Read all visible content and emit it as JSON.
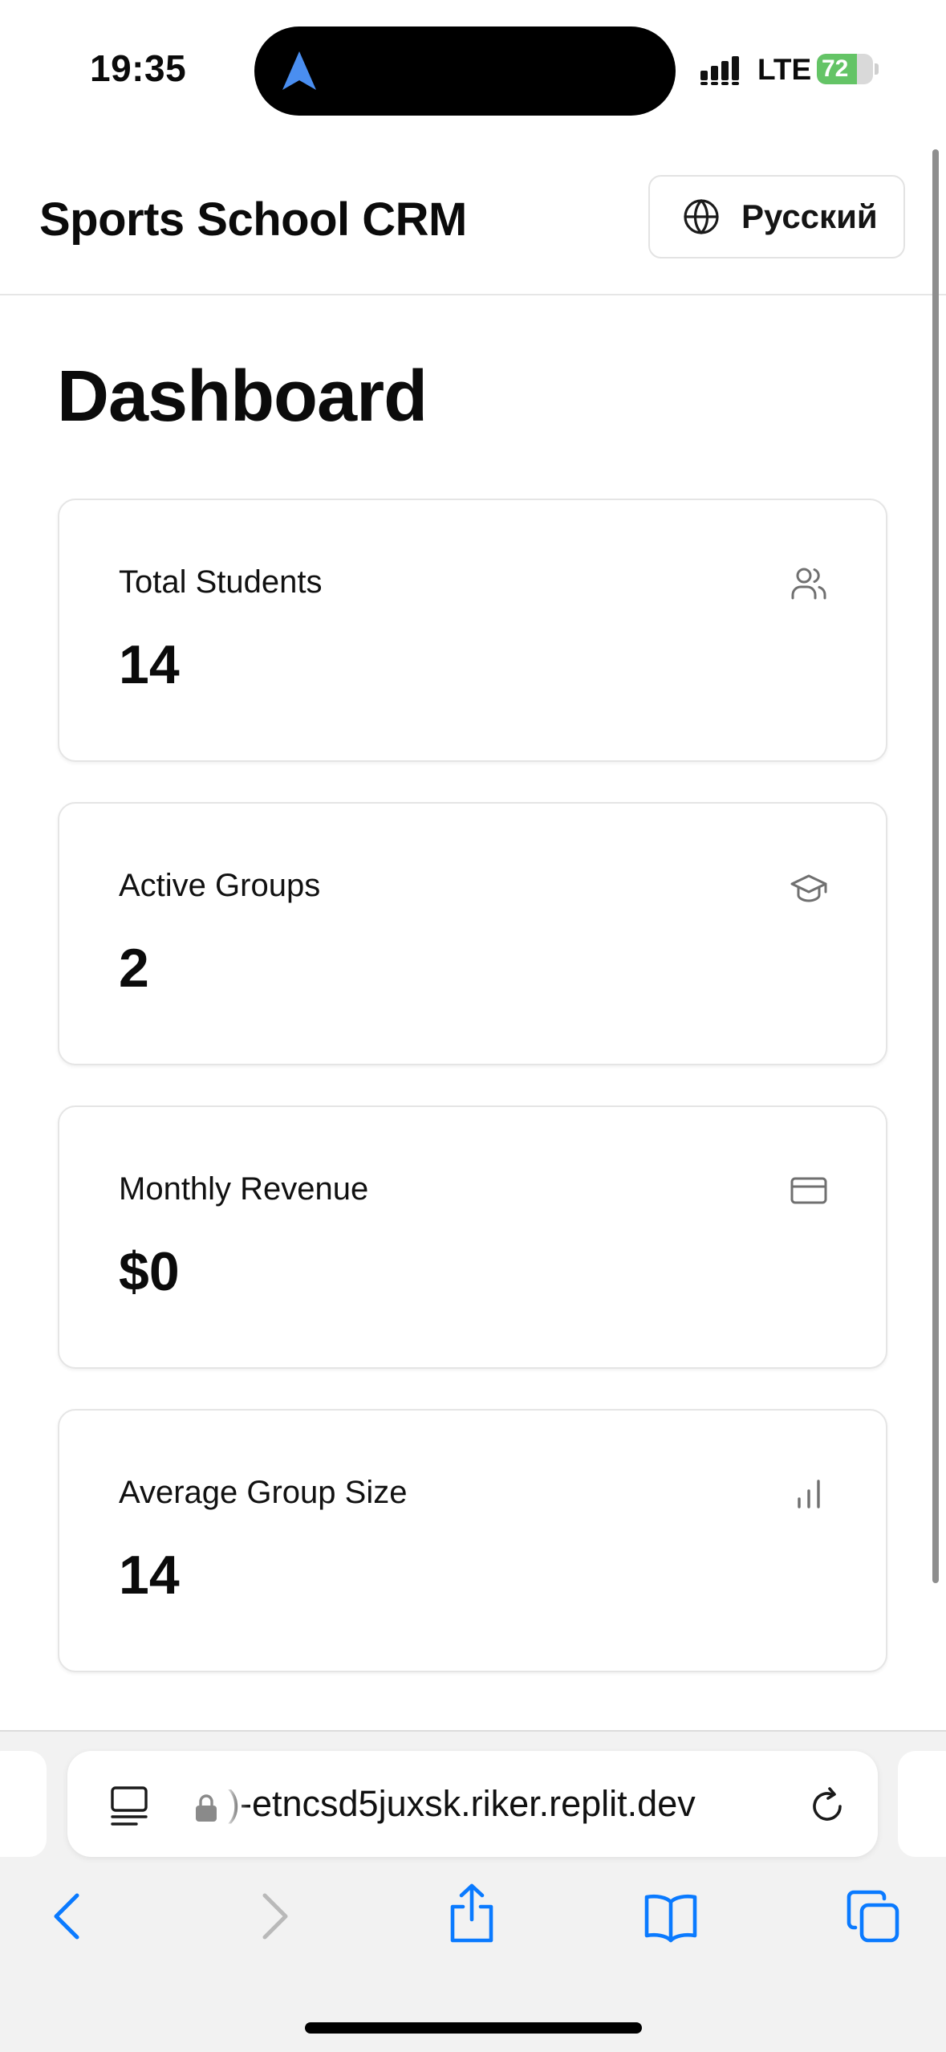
{
  "status_bar": {
    "time": "19:35",
    "network": "LTE",
    "battery_percent": "72",
    "battery_level": 0.72,
    "icons": [
      "location-arrow-icon",
      "signal-icon",
      "battery-charging-icon"
    ]
  },
  "header": {
    "app_title": "Sports School CRM",
    "language_button": "Русский",
    "language_icon": "globe-icon"
  },
  "main": {
    "page_title": "Dashboard",
    "stats": [
      {
        "label": "Total Students",
        "value": "14",
        "icon": "users-icon"
      },
      {
        "label": "Active Groups",
        "value": "2",
        "icon": "graduation-cap-icon"
      },
      {
        "label": "Monthly Revenue",
        "value": "$0",
        "icon": "credit-card-icon"
      },
      {
        "label": "Average Group Size",
        "value": "14",
        "icon": "bar-chart-icon"
      }
    ]
  },
  "browser": {
    "url": ")-etncsd5juxsk.riker.replit.dev",
    "toolbar_icons": [
      "back-icon",
      "forward-icon",
      "share-icon",
      "bookmarks-icon",
      "tabs-icon"
    ]
  },
  "colors": {
    "accent_blue": "#0a7aff",
    "location_arrow": "#4a8ef0",
    "battery_green": "#64c466",
    "card_border": "#e5e5e5",
    "icon_gray": "#707070"
  }
}
